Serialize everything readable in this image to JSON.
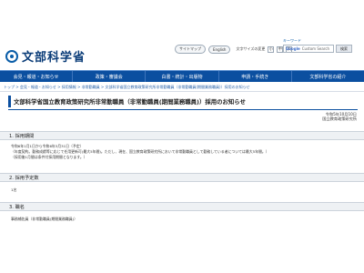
{
  "header": {
    "logo_text": "文部科学省",
    "toplinks": [
      "サイトマップ",
      "English"
    ],
    "text_size_label": "文字サイズの変更",
    "text_size_buttons": [
      "小",
      "中",
      "大"
    ],
    "search_label": "キーワード",
    "search_placeholder": "Custom Search",
    "search_google": "Google",
    "search_button": "検索"
  },
  "nav": {
    "items": [
      "会見・報道・お知らせ",
      "政策・審議会",
      "白書・統計・出版物",
      "申請・手続き",
      "文部科学省の紹介"
    ]
  },
  "breadcrumb": "トップ > 会見・報道・お知らせ > 採用情報 > 非常勤職員 > 文部科学省国立教育政策研究所非常勤職員（非常勤職員(期間業務職員)）採用のお知らせ",
  "page": {
    "title": "文部科学省国立教育政策研究所非常勤職員（非常勤職員(期間業務職員)）採用のお知らせ",
    "date": "令和5年10月10日",
    "issuer": "国立教育政策研究所"
  },
  "sections": [
    {
      "heading": "1. 採用期間",
      "lines": [
        "令和6年1月1日から令和6年3月31日（予定）",
        "（年度契約。勤務成績等に応じて任用更新可(最大5年間)。ただし、現在、国立教育政策研究所において非常勤職員として勤務している者については最大5年間。）",
        "（採用後1月間は条件付採用期間となります。）"
      ]
    },
    {
      "heading": "2. 採用予定数",
      "lines": [
        "1名"
      ]
    },
    {
      "heading": "3. 職名",
      "lines": [
        "事務補佐員（非常勤職員(期間業務職員)）"
      ]
    }
  ],
  "colors": {
    "nav_background": "#0b4fa0",
    "logo_blue": "#0a3c78",
    "link_blue": "#2a62a8",
    "section_background": "#eef1f4"
  }
}
